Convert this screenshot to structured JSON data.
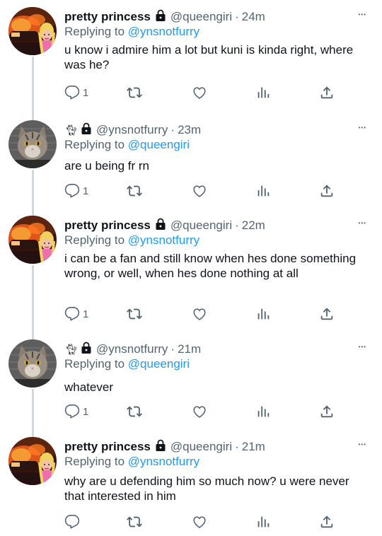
{
  "tweets": [
    {
      "name": "pretty princess",
      "handle": "@queengiri",
      "dot": "·",
      "time": "24m",
      "replying_label": "Replying to",
      "replying_to": "@ynsnotfurry",
      "text": "u know i admire him a lot but kuni is kinda right, where was he?",
      "reply_count": "1",
      "avatar": "car-fire-barbie-avatar"
    },
    {
      "name": "",
      "handle": "@ynsnotfurry",
      "dot": "·",
      "time": "23m",
      "replying_label": "Replying to",
      "replying_to": "@queengiri",
      "text": "are u being fr rn",
      "reply_count": "1",
      "avatar": "cat-mugshot-avatar"
    },
    {
      "name": "pretty princess",
      "handle": "@queengiri",
      "dot": "·",
      "time": "22m",
      "replying_label": "Replying to",
      "replying_to": "@ynsnotfurry",
      "text": "i can be a fan and still know when hes done something wrong, or well, when hes done nothing at all",
      "reply_count": "1",
      "avatar": "car-fire-barbie-avatar"
    },
    {
      "name": "",
      "handle": "@ynsnotfurry",
      "dot": "·",
      "time": "21m",
      "replying_label": "Replying to",
      "replying_to": "@queengiri",
      "text": "whatever",
      "reply_count": "1",
      "avatar": "cat-mugshot-avatar"
    },
    {
      "name": "pretty princess",
      "handle": "@queengiri",
      "dot": "·",
      "time": "21m",
      "replying_label": "Replying to",
      "replying_to": "@ynsnotfurry",
      "text": "why are u defending him so much now? u were never that interested in him",
      "reply_count": "",
      "avatar": "car-fire-barbie-avatar"
    }
  ],
  "colors": {
    "text": "#0f1419",
    "secondary": "#536471",
    "link": "#1d9bf0",
    "thread_line": "#cfd9de"
  },
  "icons": [
    "lock-icon",
    "cat-icon",
    "reply-icon",
    "retweet-icon",
    "like-icon",
    "analytics-icon",
    "share-icon",
    "more-icon"
  ]
}
